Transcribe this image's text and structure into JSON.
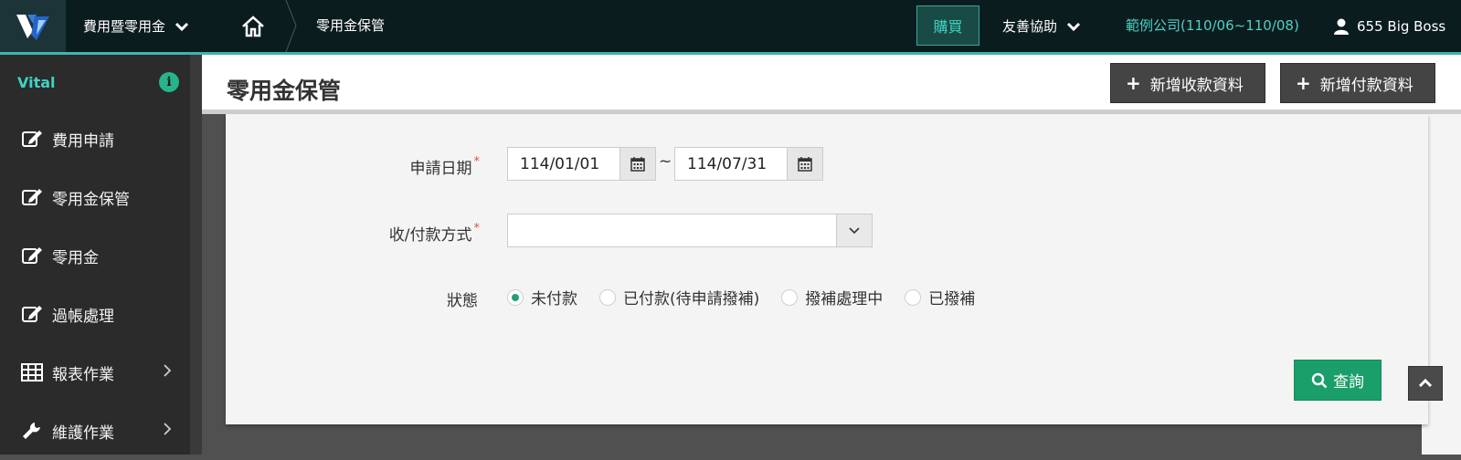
{
  "topbar": {
    "module_label": "費用暨零用金",
    "breadcrumb_current": "零用金保管",
    "buy_label": "購買",
    "assist_label": "友善協助",
    "company_label": "範例公司(110/06~110/08)",
    "user_label": "655 Big Boss"
  },
  "sidebar": {
    "brand": "Vital",
    "items": [
      {
        "label": "費用申請",
        "icon": "edit-icon"
      },
      {
        "label": "零用金保管",
        "icon": "edit-icon"
      },
      {
        "label": "零用金",
        "icon": "edit-icon"
      },
      {
        "label": "過帳處理",
        "icon": "edit-icon"
      },
      {
        "label": "報表作業",
        "icon": "table-icon"
      },
      {
        "label": "維護作業",
        "icon": "wrench-icon"
      }
    ]
  },
  "page": {
    "title": "零用金保管",
    "add_receipt_label": "新增收款資料",
    "add_payment_label": "新增付款資料"
  },
  "form": {
    "date_label": "申請日期",
    "date_from": "114/01/01",
    "date_to": "114/07/31",
    "date_separator": "~",
    "method_label": "收/付款方式",
    "method_value": "",
    "status_label": "狀態",
    "status_options": [
      "未付款",
      "已付款(待申請撥補)",
      "撥補處理中",
      "已撥補"
    ],
    "status_selected": "未付款",
    "required_mark": "*",
    "query_label": "查詢"
  },
  "colors": {
    "topbar_bg": "#0b1c1f",
    "accent_teal": "#3fb6ad",
    "company_text": "#4fd0c2",
    "primary_green": "#1a9e6a",
    "sidebar_bg": "#2b2b2b"
  }
}
